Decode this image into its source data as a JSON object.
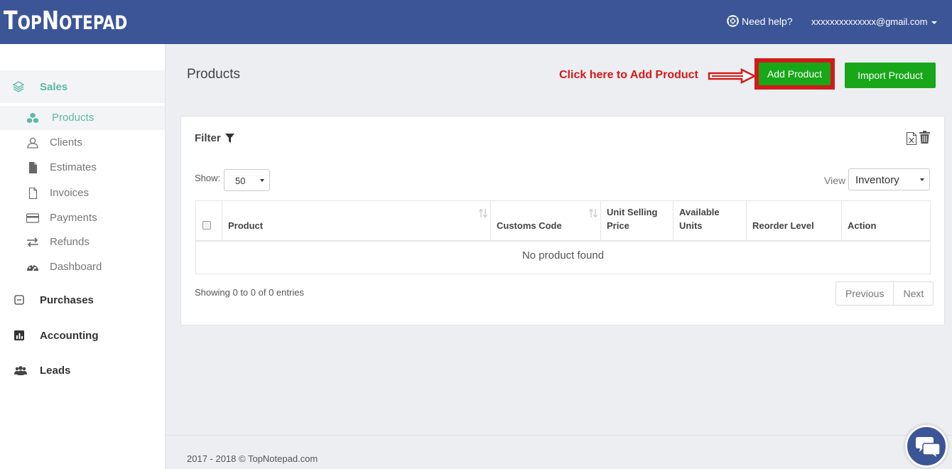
{
  "brand": {
    "logo_big": "T",
    "logo_part1": "OP",
    "logo_big2": "N",
    "logo_part2": "OTEPAD",
    "color": "#3b5597"
  },
  "header": {
    "help_label": "Need help?",
    "account_email": "xxxxxxxxxxxxxx@gmail.com"
  },
  "sidebar": {
    "sales_label": "Sales",
    "sub_items": [
      {
        "label": "Products",
        "icon": "cubes-icon"
      },
      {
        "label": "Clients",
        "icon": "user-icon"
      },
      {
        "label": "Estimates",
        "icon": "file-icon"
      },
      {
        "label": "Invoices",
        "icon": "file-outline-icon"
      },
      {
        "label": "Payments",
        "icon": "credit-card-icon"
      },
      {
        "label": "Refunds",
        "icon": "exchange-icon"
      },
      {
        "label": "Dashboard",
        "icon": "dashboard-icon"
      }
    ],
    "purchases_label": "Purchases",
    "accounting_label": "Accounting",
    "leads_label": "Leads"
  },
  "main": {
    "title": "Products",
    "annotation": "Click here to Add Product",
    "add_button": "Add Product",
    "import_button": "Import Product",
    "filter_label": "Filter",
    "show_label": "Show:",
    "show_value": "50",
    "view_label": "View",
    "view_value": "Inventory",
    "table": {
      "headers": [
        "Product",
        "Customs Code",
        "Unit Selling Price",
        "Available Units",
        "Reorder Level",
        "Action"
      ],
      "header_line1": [
        "",
        "",
        "Unit Selling",
        "Available",
        "",
        ""
      ],
      "header_line2": [
        "Product",
        "Customs Code",
        "Price",
        "Units",
        "Reorder Level",
        "Action"
      ],
      "empty_message": "No product found"
    },
    "showing_text": "Showing 0 to 0 of 0 entries",
    "pager": {
      "previous": "Previous",
      "next": "Next"
    }
  },
  "footer": {
    "text": "2017 - 2018 © TopNotepad.com"
  },
  "colors": {
    "accent_green": "#18a718",
    "teal": "#5cb8a2",
    "annotation_red": "#d21a1a"
  }
}
